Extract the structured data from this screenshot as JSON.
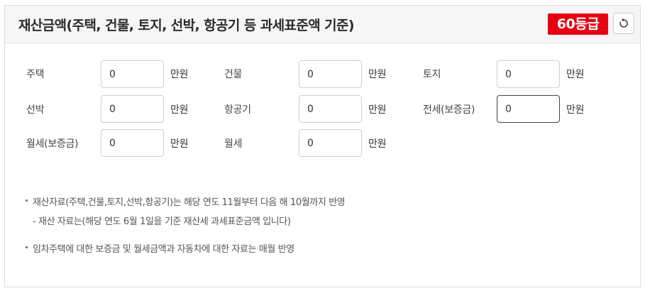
{
  "header": {
    "title": "재산금액(주택, 건물, 토지, 선박, 항공기 등 과세표준액 기준)",
    "grade_badge": "60등급",
    "reset_icon": "refresh-icon"
  },
  "unit": "만원",
  "fields": [
    {
      "label": "주택",
      "value": "0"
    },
    {
      "label": "건물",
      "value": "0"
    },
    {
      "label": "토지",
      "value": "0"
    },
    {
      "label": "선박",
      "value": "0"
    },
    {
      "label": "항공기",
      "value": "0"
    },
    {
      "label": "전세(보증금)",
      "value": "0"
    },
    {
      "label": "월세(보증금)",
      "value": "0"
    },
    {
      "label": "월세",
      "value": "0"
    }
  ],
  "notes": {
    "note1": "재산자료(주택,건물,토지,선박,항공기)는 해당 연도 11월부터 다음 해 10월까지 반영",
    "note1_sub": "- 재산 자료는(해당 연도 6월 1일을 기준 재산세 과세표준금액 입니다)",
    "note2": "임차주택에 대한 보증금 및 월세금액과 자동차에 대한 자료는 매월 반영"
  },
  "colors": {
    "badge": "#e60012",
    "header_bg": "#f6f6f6",
    "border": "#dcdcdc"
  }
}
